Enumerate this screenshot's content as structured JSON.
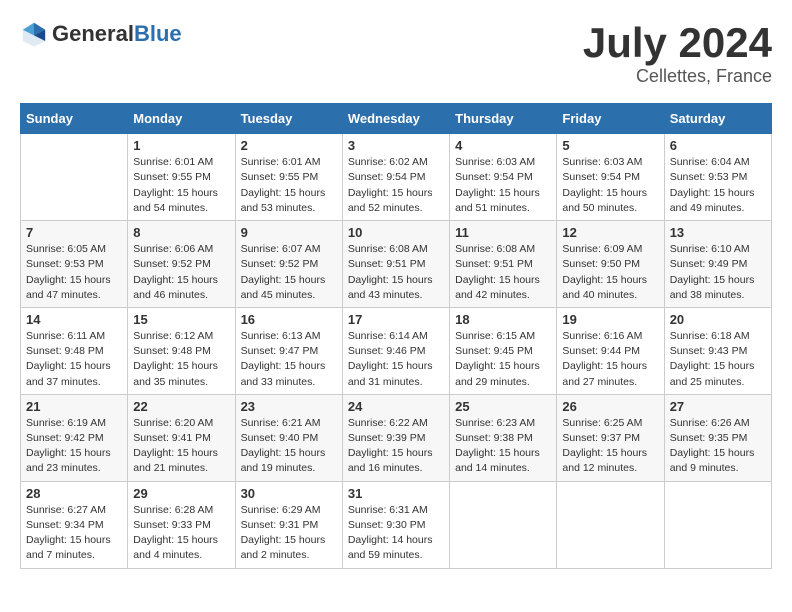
{
  "header": {
    "logo": {
      "general": "General",
      "blue": "Blue"
    },
    "title": "July 2024",
    "subtitle": "Cellettes, France"
  },
  "calendar": {
    "days_of_week": [
      "Sunday",
      "Monday",
      "Tuesday",
      "Wednesday",
      "Thursday",
      "Friday",
      "Saturday"
    ],
    "weeks": [
      [
        {
          "day": "",
          "info": ""
        },
        {
          "day": "1",
          "info": "Sunrise: 6:01 AM\nSunset: 9:55 PM\nDaylight: 15 hours\nand 54 minutes."
        },
        {
          "day": "2",
          "info": "Sunrise: 6:01 AM\nSunset: 9:55 PM\nDaylight: 15 hours\nand 53 minutes."
        },
        {
          "day": "3",
          "info": "Sunrise: 6:02 AM\nSunset: 9:54 PM\nDaylight: 15 hours\nand 52 minutes."
        },
        {
          "day": "4",
          "info": "Sunrise: 6:03 AM\nSunset: 9:54 PM\nDaylight: 15 hours\nand 51 minutes."
        },
        {
          "day": "5",
          "info": "Sunrise: 6:03 AM\nSunset: 9:54 PM\nDaylight: 15 hours\nand 50 minutes."
        },
        {
          "day": "6",
          "info": "Sunrise: 6:04 AM\nSunset: 9:53 PM\nDaylight: 15 hours\nand 49 minutes."
        }
      ],
      [
        {
          "day": "7",
          "info": "Sunrise: 6:05 AM\nSunset: 9:53 PM\nDaylight: 15 hours\nand 47 minutes."
        },
        {
          "day": "8",
          "info": "Sunrise: 6:06 AM\nSunset: 9:52 PM\nDaylight: 15 hours\nand 46 minutes."
        },
        {
          "day": "9",
          "info": "Sunrise: 6:07 AM\nSunset: 9:52 PM\nDaylight: 15 hours\nand 45 minutes."
        },
        {
          "day": "10",
          "info": "Sunrise: 6:08 AM\nSunset: 9:51 PM\nDaylight: 15 hours\nand 43 minutes."
        },
        {
          "day": "11",
          "info": "Sunrise: 6:08 AM\nSunset: 9:51 PM\nDaylight: 15 hours\nand 42 minutes."
        },
        {
          "day": "12",
          "info": "Sunrise: 6:09 AM\nSunset: 9:50 PM\nDaylight: 15 hours\nand 40 minutes."
        },
        {
          "day": "13",
          "info": "Sunrise: 6:10 AM\nSunset: 9:49 PM\nDaylight: 15 hours\nand 38 minutes."
        }
      ],
      [
        {
          "day": "14",
          "info": "Sunrise: 6:11 AM\nSunset: 9:48 PM\nDaylight: 15 hours\nand 37 minutes."
        },
        {
          "day": "15",
          "info": "Sunrise: 6:12 AM\nSunset: 9:48 PM\nDaylight: 15 hours\nand 35 minutes."
        },
        {
          "day": "16",
          "info": "Sunrise: 6:13 AM\nSunset: 9:47 PM\nDaylight: 15 hours\nand 33 minutes."
        },
        {
          "day": "17",
          "info": "Sunrise: 6:14 AM\nSunset: 9:46 PM\nDaylight: 15 hours\nand 31 minutes."
        },
        {
          "day": "18",
          "info": "Sunrise: 6:15 AM\nSunset: 9:45 PM\nDaylight: 15 hours\nand 29 minutes."
        },
        {
          "day": "19",
          "info": "Sunrise: 6:16 AM\nSunset: 9:44 PM\nDaylight: 15 hours\nand 27 minutes."
        },
        {
          "day": "20",
          "info": "Sunrise: 6:18 AM\nSunset: 9:43 PM\nDaylight: 15 hours\nand 25 minutes."
        }
      ],
      [
        {
          "day": "21",
          "info": "Sunrise: 6:19 AM\nSunset: 9:42 PM\nDaylight: 15 hours\nand 23 minutes."
        },
        {
          "day": "22",
          "info": "Sunrise: 6:20 AM\nSunset: 9:41 PM\nDaylight: 15 hours\nand 21 minutes."
        },
        {
          "day": "23",
          "info": "Sunrise: 6:21 AM\nSunset: 9:40 PM\nDaylight: 15 hours\nand 19 minutes."
        },
        {
          "day": "24",
          "info": "Sunrise: 6:22 AM\nSunset: 9:39 PM\nDaylight: 15 hours\nand 16 minutes."
        },
        {
          "day": "25",
          "info": "Sunrise: 6:23 AM\nSunset: 9:38 PM\nDaylight: 15 hours\nand 14 minutes."
        },
        {
          "day": "26",
          "info": "Sunrise: 6:25 AM\nSunset: 9:37 PM\nDaylight: 15 hours\nand 12 minutes."
        },
        {
          "day": "27",
          "info": "Sunrise: 6:26 AM\nSunset: 9:35 PM\nDaylight: 15 hours\nand 9 minutes."
        }
      ],
      [
        {
          "day": "28",
          "info": "Sunrise: 6:27 AM\nSunset: 9:34 PM\nDaylight: 15 hours\nand 7 minutes."
        },
        {
          "day": "29",
          "info": "Sunrise: 6:28 AM\nSunset: 9:33 PM\nDaylight: 15 hours\nand 4 minutes."
        },
        {
          "day": "30",
          "info": "Sunrise: 6:29 AM\nSunset: 9:31 PM\nDaylight: 15 hours\nand 2 minutes."
        },
        {
          "day": "31",
          "info": "Sunrise: 6:31 AM\nSunset: 9:30 PM\nDaylight: 14 hours\nand 59 minutes."
        },
        {
          "day": "",
          "info": ""
        },
        {
          "day": "",
          "info": ""
        },
        {
          "day": "",
          "info": ""
        }
      ]
    ]
  }
}
